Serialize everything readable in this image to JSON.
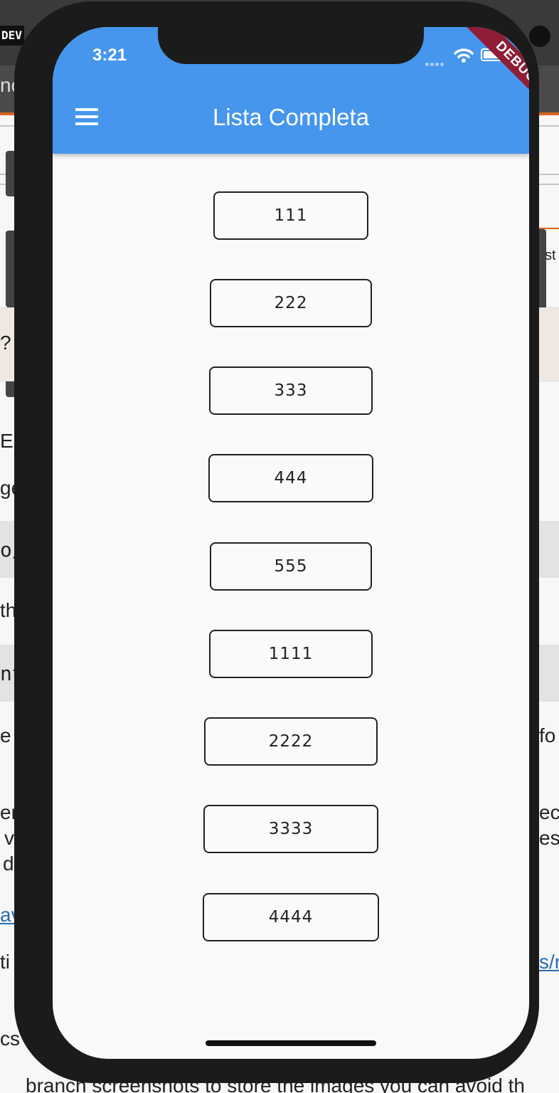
{
  "background_page": {
    "dev_badge": "DEV",
    "fragments": {
      "f1": "nc",
      "f2": "st",
      "f3": "?",
      "f4": "E.r",
      "f5": "ge",
      "f6": "o/",
      "f7": "th",
      "f8": "nt",
      "f9": "e",
      "f10": "fo",
      "f11": "er",
      "f12": "v",
      "f13": "d",
      "f14": "ec",
      "f15": "es",
      "f16": "av",
      "f17": "ti",
      "f18": "s/r",
      "f19": "cs",
      "bottom": "branch  screenshots  to store the images you can avoid th"
    }
  },
  "status_bar": {
    "time": "3:21",
    "debug_label": "DEBUG"
  },
  "app_bar": {
    "title": "Lista Completa"
  },
  "list": {
    "items": [
      "111",
      "222",
      "333",
      "444",
      "555",
      "1111",
      "2222",
      "3333",
      "4444"
    ]
  }
}
